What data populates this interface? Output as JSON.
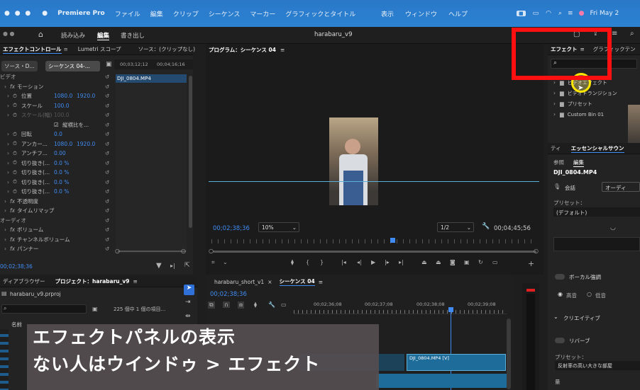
{
  "menubar": {
    "app": "Premiere Pro",
    "items": [
      "ファイル",
      "編集",
      "クリップ",
      "シーケンス",
      "マーカー",
      "グラフィックとタイトル"
    ],
    "right_items": [
      "表示",
      "ウィンドウ",
      "ヘルプ"
    ],
    "clock": "Fri May 2"
  },
  "toolbar": {
    "tabs": [
      "読み込み",
      "編集",
      "書き出し"
    ],
    "active": "編集",
    "project_title": "harabaru_v9"
  },
  "effect_controls": {
    "tabs": [
      "エフェクトコントロール",
      "Lumetri スコープ",
      "ソース：(クリップなし)"
    ],
    "source_chip": "ソース・D...",
    "sequence_chip": "シーケンス 04-...",
    "ruler": [
      "00;03;12;12",
      "00;04;16;16"
    ],
    "clip": "DJI_0804.MP4",
    "rows": [
      {
        "label": "ビデオ",
        "indent": 0
      },
      {
        "label": "モーション",
        "indent": 1,
        "fx": true
      },
      {
        "label": "位置",
        "indent": 2,
        "v1": "1080.0",
        "v2": "1920.0"
      },
      {
        "label": "スケール",
        "indent": 2,
        "v1": "100.0"
      },
      {
        "label": "スケール(幅)",
        "indent": 2,
        "v1": "100.0",
        "dim": true
      },
      {
        "label": "縦横比を...",
        "indent": 3,
        "check": true
      },
      {
        "label": "回転",
        "indent": 2,
        "v1": "0.0"
      },
      {
        "label": "アンカー...",
        "indent": 2,
        "v1": "1080.0",
        "v2": "1920.0"
      },
      {
        "label": "アンチフ...",
        "indent": 2,
        "v1": "0.00"
      },
      {
        "label": "切り抜き(...",
        "indent": 2,
        "v1": "0.0 %"
      },
      {
        "label": "切り抜き(...",
        "indent": 2,
        "v1": "0.0 %"
      },
      {
        "label": "切り抜き(...",
        "indent": 2,
        "v1": "0.0 %"
      },
      {
        "label": "切り抜き(...",
        "indent": 2,
        "v1": "0.0 %"
      },
      {
        "label": "不透明度",
        "indent": 1,
        "fx": true
      },
      {
        "label": "タイムリマップ",
        "indent": 1,
        "fx": true
      },
      {
        "label": "オーディオ",
        "indent": 0
      },
      {
        "label": "ボリューム",
        "indent": 1,
        "fx": true
      },
      {
        "label": "チャンネルボリューム",
        "indent": 1,
        "fx": true
      },
      {
        "label": "パンナー",
        "indent": 1,
        "fx": true
      }
    ],
    "timecode": "00;02;38;36"
  },
  "program": {
    "title": "プログラム：シーケンス 04",
    "timecode": "00;02;38;36",
    "zoom": "10%",
    "resolution": "1/2",
    "duration": "00;04;45;56",
    "playhead_fraction": 0.55
  },
  "project": {
    "tabs": [
      "ディアブラウザー",
      "プロジェクト：harabaru_v9"
    ],
    "file": "harabaru_v9.prproj",
    "count": "225 個中 1 個の項目...",
    "col_name": "名前"
  },
  "timeline": {
    "tabs": [
      "harabaru_short_v1",
      "シーケンス 04"
    ],
    "timecode": "00;02;38;36",
    "ruler": [
      "00;02;36;08",
      "00;02;37;08",
      "00;02;38;08",
      "00;02;39;08"
    ],
    "clip1": "DJI_0804.MP4 [V]",
    "clip2": "DJI_0804.MP4 [V]"
  },
  "effects": {
    "tabs": [
      "エフェクト",
      "グラフィックテン"
    ],
    "tree": [
      "ビデオエフェクト",
      "ビデオトランジション",
      "プリセット",
      "Custom Bin 01"
    ]
  },
  "essential": {
    "tabs": [
      "ティ",
      "エッセンシャルサウン"
    ],
    "subtabs": [
      "参照",
      "編集"
    ],
    "clip": "DJI_0804.MP4",
    "type_label": "会話",
    "type_btn": "オーディ",
    "preset_label": "プリセット：",
    "preset_val": "(デフォルト)",
    "vocal": "ボーカル強調",
    "high": "高音",
    "low": "低音",
    "creative": "クリエイティブ",
    "reverb": "リバーブ",
    "preset2_label": "プリセット：",
    "preset2_val": "反射率の高い大きな部屋",
    "amount": "量"
  },
  "overlay": {
    "line1": "エフェクトパネルの表示",
    "line2": "ない人はウインドゥ > エフェクト"
  },
  "colors": {
    "menubar": "#2b7fd0",
    "accent": "#3f8bf2",
    "highlight": "#ff1010"
  }
}
